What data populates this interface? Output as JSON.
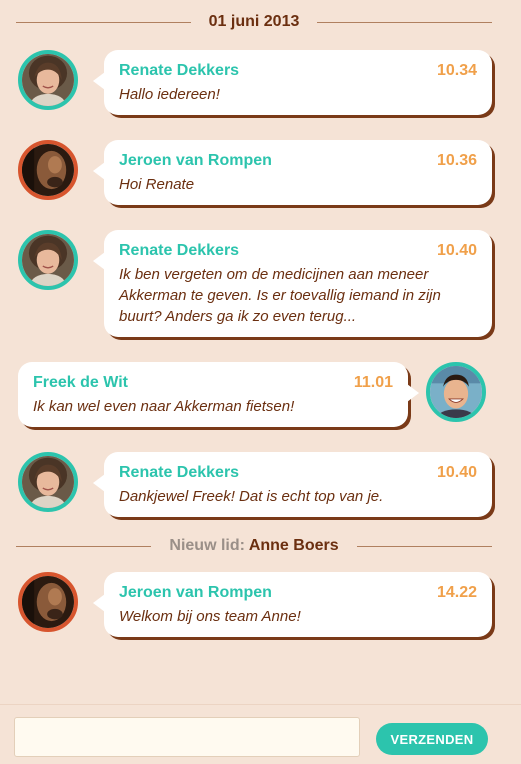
{
  "date_divider": "01 juni 2013",
  "messages": [
    {
      "name": "Renate Dekkers",
      "time": "10.34",
      "text": "Hallo iedereen!",
      "avatar": "woman-portrait-icon"
    },
    {
      "name": "Jeroen van Rompen",
      "time": "10.36",
      "text": "Hoi Renate",
      "avatar": "man-portrait-icon"
    },
    {
      "name": "Renate Dekkers",
      "time": "10.40",
      "text": "Ik ben vergeten om de medicijnen aan meneer Akkerman te geven. Is er toevallig iemand in zijn buurt? Anders ga ik zo even terug...",
      "avatar": "woman-portrait-icon"
    },
    {
      "name": "Freek de Wit",
      "time": "11.01",
      "text": "Ik kan wel even naar Akkerman fietsen!",
      "avatar": "young-man-portrait-icon"
    },
    {
      "name": "Renate Dekkers",
      "time": "10.40",
      "text": "Dankjewel Freek! Dat is echt top van je.",
      "avatar": "woman-portrait-icon"
    },
    {
      "name": "Jeroen van Rompen",
      "time": "14.22",
      "text": "Welkom bij ons team Anne!",
      "avatar": "man-portrait-icon"
    }
  ],
  "new_member": {
    "prefix": "Nieuw lid:",
    "name": "Anne Boers"
  },
  "composer": {
    "placeholder": "",
    "send_label": "VERZENDEN"
  },
  "colors": {
    "background": "#f5e3d6",
    "accent_teal": "#2cc4ad",
    "time_orange": "#f0a04a",
    "text_brown": "#6b2f10",
    "avatar_border_orange": "#d7552e"
  }
}
